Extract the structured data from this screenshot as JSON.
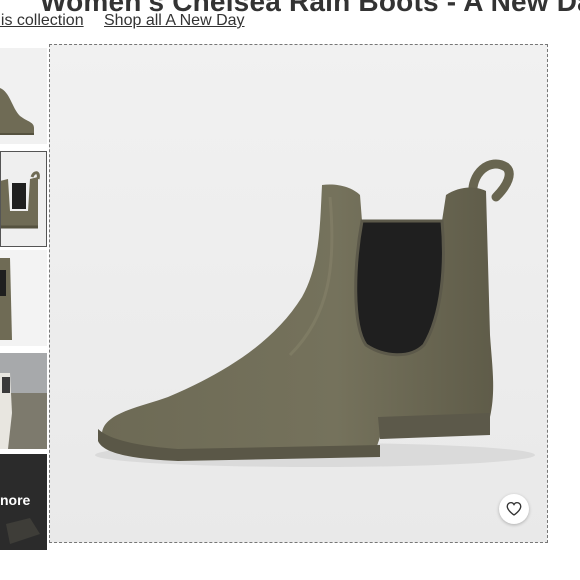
{
  "product": {
    "title": "Women's Chelsea Rain Boots - A New Day"
  },
  "links": {
    "collection": "his collection",
    "shop_brand": "Shop all A New Day"
  },
  "thumbnails": {
    "more_label": "nore",
    "selected_index": 1
  },
  "actions": {
    "favorite_icon": "heart-icon"
  },
  "colors": {
    "boot_olive": "#6f6b55",
    "elastic_panel": "#1f1f1f",
    "background": "#f2f2f2"
  }
}
